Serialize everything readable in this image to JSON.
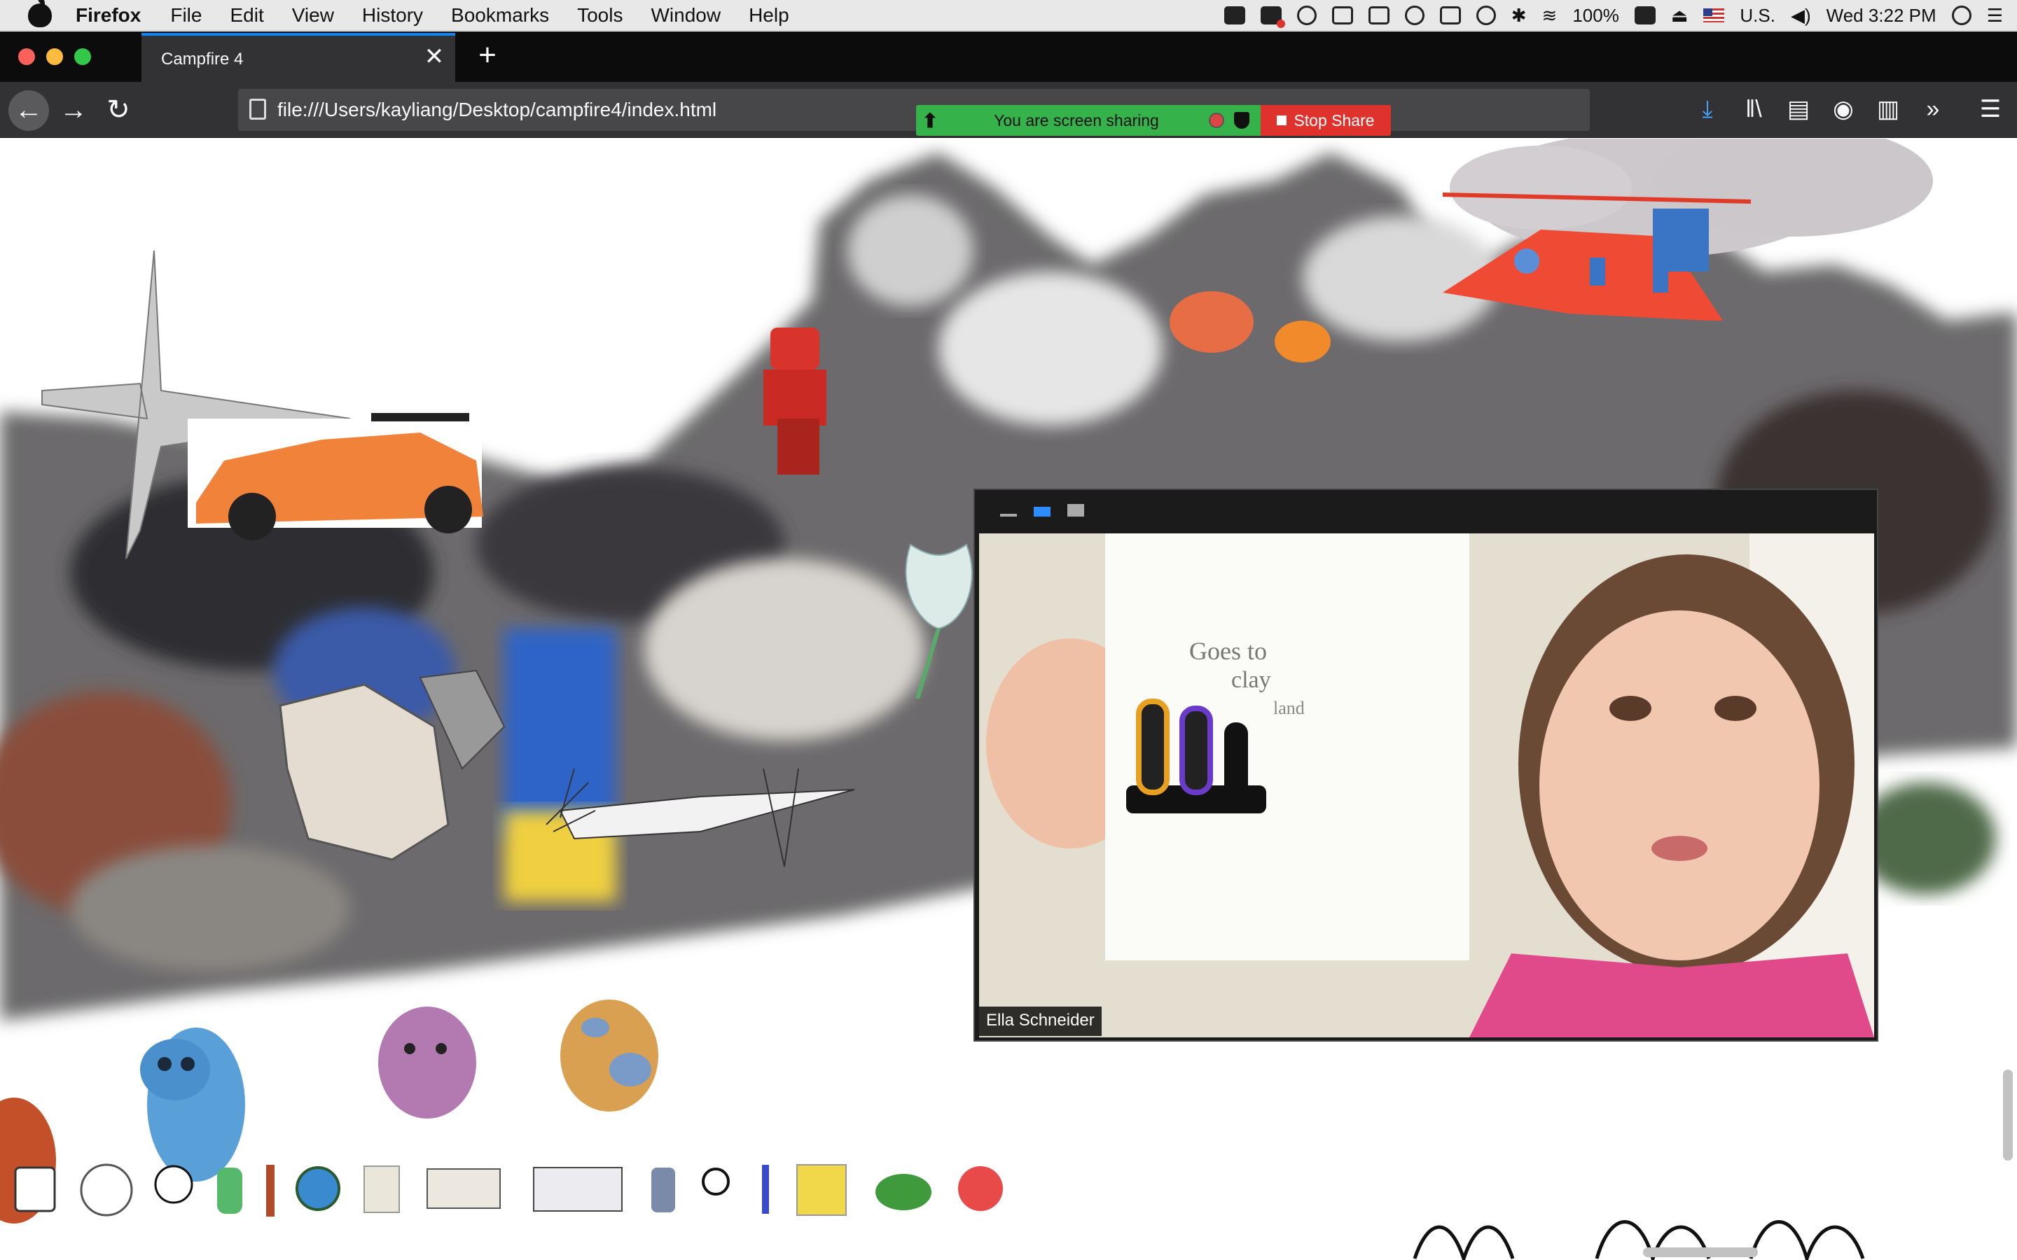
{
  "menubar": {
    "app_name": "Firefox",
    "items": [
      "File",
      "Edit",
      "View",
      "History",
      "Bookmarks",
      "Tools",
      "Window",
      "Help"
    ],
    "battery": "100%",
    "input_source": "U.S.",
    "clock": "Wed 3:22 PM",
    "status_icons": [
      "zoom-icon",
      "screen-record-icon",
      "creative-cloud-icon",
      "display-icon",
      "copy-icon",
      "vpn-icon",
      "cast-icon",
      "time-machine-icon",
      "bluetooth-icon",
      "wifi-icon",
      "battery-icon",
      "eject-icon",
      "flag-icon",
      "volume-icon",
      "spotlight-icon",
      "notification-center-icon"
    ]
  },
  "browser": {
    "tab_title": "Campfire 4",
    "url": "file:///Users/kayliang/Desktop/campfire4/index.html",
    "toolbar_icons": [
      "download-icon",
      "library-icon",
      "sidebar-icon",
      "account-icon",
      "extension-icon",
      "overflow-icon",
      "hamburger-menu-icon"
    ]
  },
  "share_banner": {
    "message": "You are screen sharing",
    "stop_label": "Stop Share",
    "colors": {
      "banner": "#36b24b",
      "stop": "#e0322c"
    }
  },
  "video_panel": {
    "participant_name": "Ella Schneider",
    "drawing_text": [
      "Goes to",
      "clay",
      "land"
    ]
  },
  "scene_items": [
    "paper-airplane-drawing",
    "lego-race-car",
    "ninja-minifigure",
    "lion-figure",
    "fish-figure",
    "helicopter-drawing",
    "cloud-drawing",
    "flower-drawing",
    "crumpled-paper-sculpture",
    "drawn-spaceship",
    "droid-robot-figure",
    "blue-dinosaur-figure",
    "purple-squirrel-figure",
    "spotted-cow-figure",
    "paper-grass-drawing"
  ],
  "dock_items": [
    "dice-icon",
    "color-wheel-icon",
    "lightbulb-icon",
    "glue-bottle-icon",
    "paintbrush-icon",
    "globe-icon",
    "notepad-icon",
    "sticker-sheet-icon",
    "paper-drawing-icon",
    "bag-icon",
    "magnifier-icon",
    "marker-icon",
    "sticky-notes-icon",
    "turtle-icon",
    "red-ball-icon"
  ]
}
